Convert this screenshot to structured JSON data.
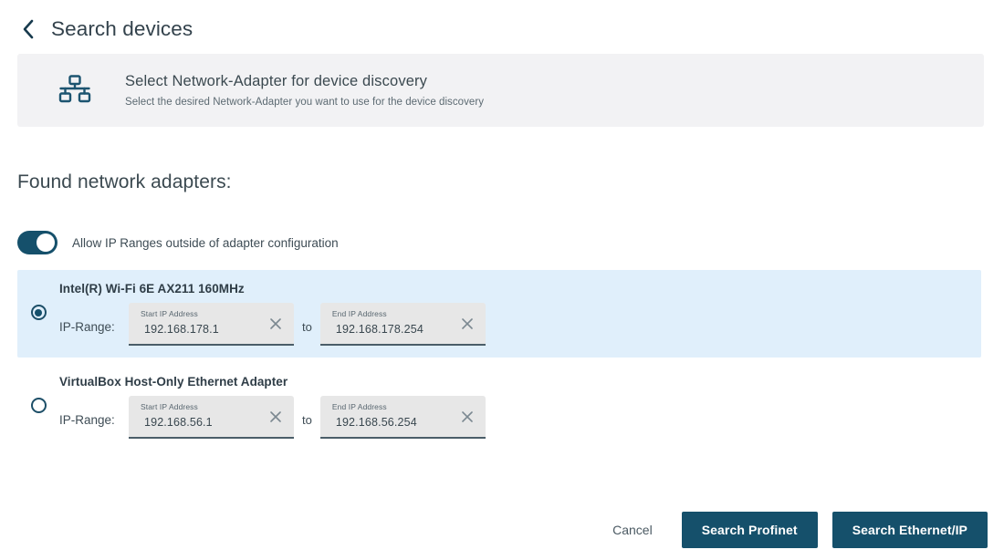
{
  "header": {
    "back_icon": "chevron-left-icon",
    "title": "Search devices"
  },
  "banner": {
    "icon": "network-topology-icon",
    "title": "Select Network-Adapter for device discovery",
    "subtitle": "Select the desired Network-Adapter you want to use for the device discovery",
    "background": "#f2f2f4"
  },
  "section": {
    "heading": "Found network adapters:"
  },
  "toggle": {
    "label": "Allow IP Ranges outside of adapter configuration",
    "state": "on",
    "on_color": "#15506b"
  },
  "adapters": [
    {
      "name": "Intel(R) Wi-Fi 6E AX211 160MHz",
      "selected": true,
      "range_label": "IP-Range:",
      "separator": "to",
      "start": {
        "label": "Start IP Address",
        "value": "192.168.178.1",
        "clear_icon": "close-icon"
      },
      "end": {
        "label": "End IP Address",
        "value": "192.168.178.254",
        "clear_icon": "close-icon"
      },
      "highlight_color": "#e0effb"
    },
    {
      "name": "VirtualBox Host-Only Ethernet Adapter",
      "selected": false,
      "range_label": "IP-Range:",
      "separator": "to",
      "start": {
        "label": "Start IP Address",
        "value": "192.168.56.1",
        "clear_icon": "close-icon"
      },
      "end": {
        "label": "End IP Address",
        "value": "192.168.56.254",
        "clear_icon": "close-icon"
      },
      "highlight_color": "#ffffff"
    }
  ],
  "footer": {
    "cancel_label": "Cancel",
    "search_profinet_label": "Search Profinet",
    "search_ethernetip_label": "Search Ethernet/IP",
    "primary_color": "#15506b"
  }
}
